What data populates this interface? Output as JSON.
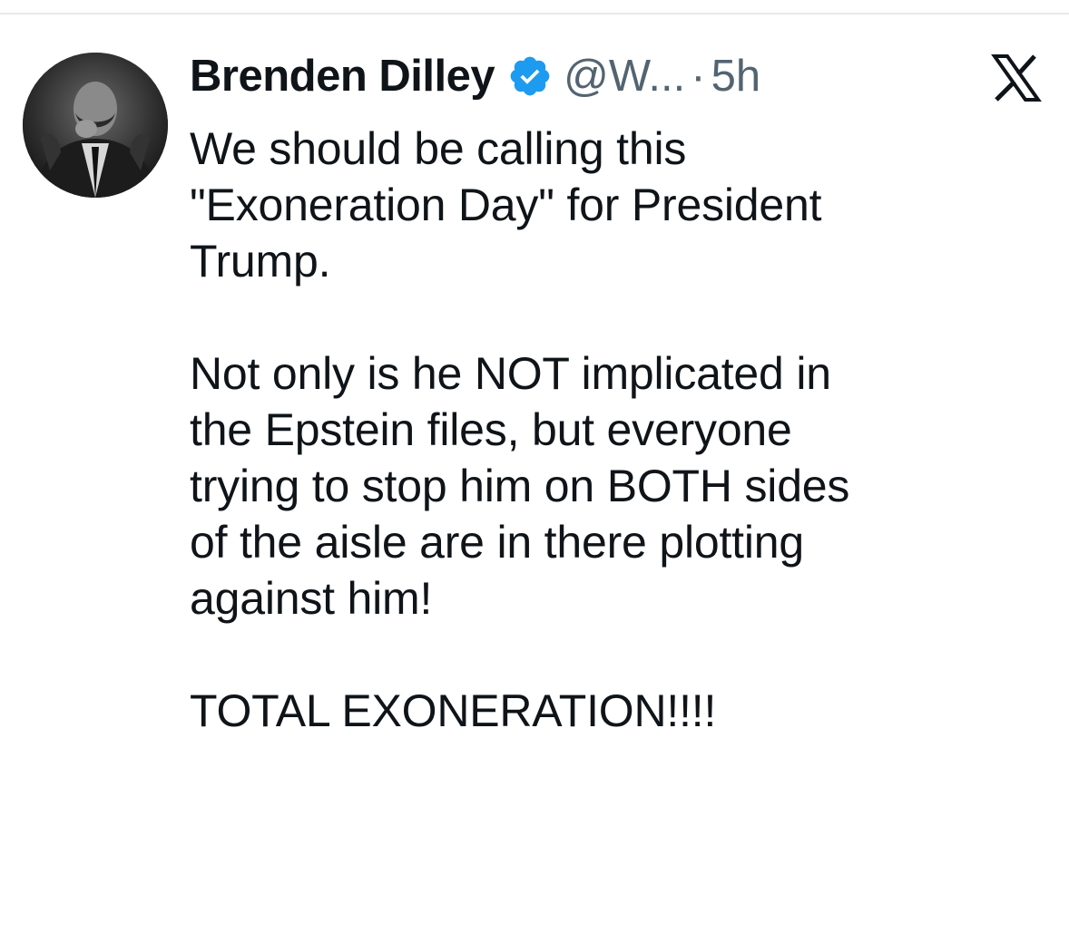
{
  "tweet": {
    "author_name": "Brenden Dilley",
    "handle": "@W...",
    "separator": "·",
    "time": "5h",
    "verified_icon": "verified-badge-icon",
    "platform_icon": "x-logo-icon",
    "text": "We should be calling this\n\"Exoneration Day\" for President\nTrump.\n\nNot only is he NOT implicated in\nthe Epstein files, but everyone\ntrying to stop him on BOTH sides\nof the aisle are in there plotting\nagainst him!\n\nTOTAL EXONERATION!!!!"
  },
  "colors": {
    "name": "#0f1419",
    "secondary": "#536471",
    "verified": "#1d9bf0",
    "divider": "#e6e9ec"
  }
}
